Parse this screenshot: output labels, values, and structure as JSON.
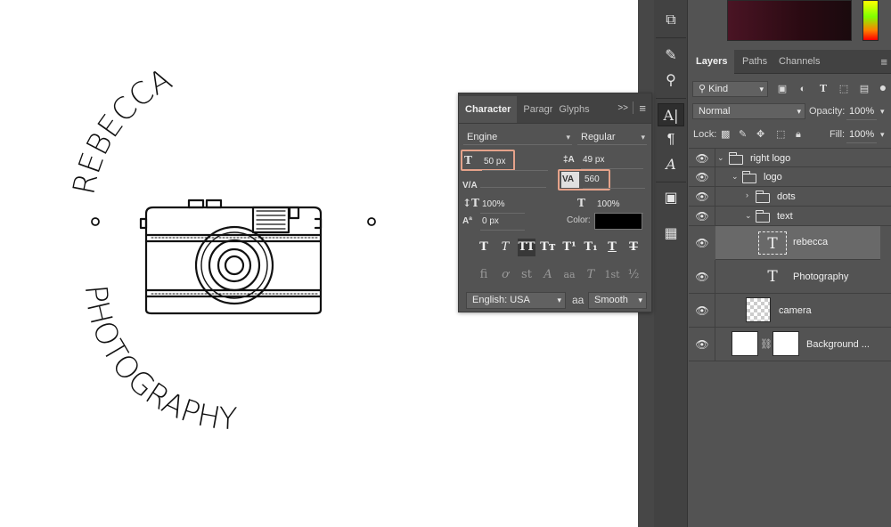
{
  "artwork": {
    "top_text": "REBECCA",
    "bottom_text": "PHOTOGRAPHY"
  },
  "character_panel": {
    "tabs": [
      "Character",
      "Paragra",
      "Glyphs"
    ],
    "collapse_label": ">>",
    "font_family": "Engine",
    "font_style": "Regular",
    "font_size": "50 px",
    "leading": "49 px",
    "kerning": "",
    "tracking": "560",
    "vertical_scale": "100%",
    "horizontal_scale": "100%",
    "baseline_shift": "0 px",
    "color_label": "Color:",
    "color_value": "#000000",
    "style_buttons": [
      "T",
      "T",
      "TT",
      "Tт",
      "T¹",
      "T₁",
      "T",
      "T"
    ],
    "opentype_buttons": [
      "fi",
      "ơ",
      "st",
      "A",
      "aa",
      "T",
      "1st",
      "½"
    ],
    "language": "English: USA",
    "aa_label": "aa",
    "antialias": "Smooth"
  },
  "layers_panel": {
    "tabs": [
      "Layers",
      "Paths",
      "Channels"
    ],
    "filter_kind": "Kind",
    "blend_mode": "Normal",
    "opacity_label": "Opacity:",
    "opacity_value": "100%",
    "lock_label": "Lock:",
    "fill_label": "Fill:",
    "fill_value": "100%",
    "layers": [
      {
        "name": "right logo",
        "type": "group",
        "indent": 0,
        "expanded": true
      },
      {
        "name": "logo",
        "type": "group",
        "indent": 1,
        "expanded": true
      },
      {
        "name": "dots",
        "type": "group",
        "indent": 2,
        "expanded": false
      },
      {
        "name": "text",
        "type": "group",
        "indent": 2,
        "expanded": true
      },
      {
        "name": "rebecca",
        "type": "text",
        "indent": 3,
        "selected": true
      },
      {
        "name": "Photography",
        "type": "text",
        "indent": 3
      },
      {
        "name": "camera",
        "type": "smart-object",
        "indent": 2
      },
      {
        "name": "Background ...",
        "type": "layer",
        "indent": 0
      }
    ]
  },
  "colors": {
    "panel_bg": "#535353",
    "panel_dark": "#424242",
    "highlight_box": "#e5a28a",
    "selected_layer": "#696969"
  }
}
